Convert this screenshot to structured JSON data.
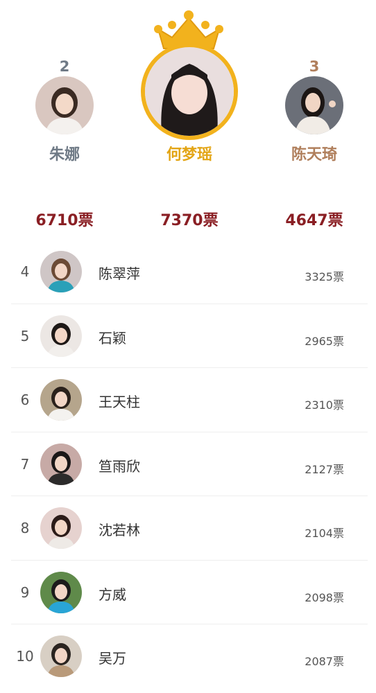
{
  "podium": [
    {
      "rank": "2",
      "name": "朱娜",
      "votes": "6710票",
      "avatar_bg": "#d9c7c0",
      "hair": "#3a2a22",
      "shirt": "#f4f1ee"
    },
    {
      "rank": "1",
      "name": "何梦瑶",
      "votes": "7370票",
      "avatar_bg": "#e9dede",
      "hair": "#1f1a1a",
      "shirt": "#2b2525"
    },
    {
      "rank": "3",
      "name": "陈天琦",
      "votes": "4647票",
      "avatar_bg": "#6b6f78",
      "hair": "#1c1614",
      "shirt": "#f1ece6"
    }
  ],
  "colors": {
    "rank2": "#6f7a86",
    "rank1": "#e3a515",
    "rank3": "#b07f5c",
    "votes": "#8a1f24",
    "crown": "#f2b21d"
  },
  "crown_icon": "crown-icon",
  "list": [
    {
      "rank": "4",
      "name": "陈翠萍",
      "votes": "3325票",
      "bg": "#cfc6c6",
      "hair": "#6b4a35",
      "shirt": "#2aa0b8"
    },
    {
      "rank": "5",
      "name": "石颖",
      "votes": "2965票",
      "bg": "#ece7e4",
      "hair": "#1d1816",
      "shirt": "#f2efec"
    },
    {
      "rank": "6",
      "name": "王天柱",
      "votes": "2310票",
      "bg": "#b5a58c",
      "hair": "#2a211b",
      "shirt": "#f4f2ef"
    },
    {
      "rank": "7",
      "name": "笪雨欣",
      "votes": "2127票",
      "bg": "#c7aaa6",
      "hair": "#1a1717",
      "shirt": "#2c2b2b"
    },
    {
      "rank": "8",
      "name": "沈若林",
      "votes": "2104票",
      "bg": "#e6d2cf",
      "hair": "#2b1b18",
      "shirt": "#eeeae6"
    },
    {
      "rank": "9",
      "name": "方威",
      "votes": "2098票",
      "bg": "#5f8a4a",
      "hair": "#1b1b1b",
      "shirt": "#29a5d6"
    },
    {
      "rank": "10",
      "name": "吴万",
      "votes": "2087票",
      "bg": "#d8cfc4",
      "hair": "#2a2420",
      "shirt": "#b99a7a"
    }
  ]
}
